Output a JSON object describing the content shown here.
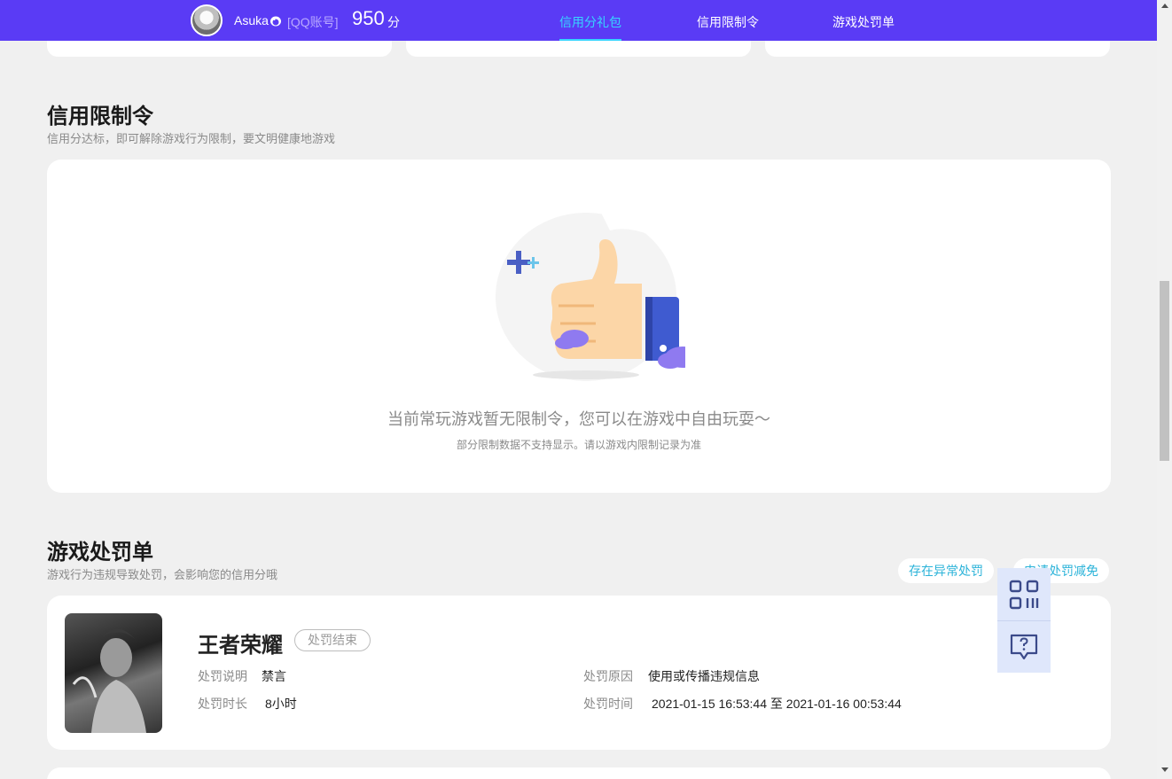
{
  "header": {
    "username": "Asuka",
    "account_tag": "[QQ账号]",
    "score": "950",
    "score_unit": "分",
    "tabs": [
      {
        "label": "信用分礼包",
        "active": true
      },
      {
        "label": "信用限制令",
        "active": false
      },
      {
        "label": "游戏处罚单",
        "active": false
      }
    ]
  },
  "restrictions": {
    "title": "信用限制令",
    "subtitle": "信用分达标，即可解除游戏行为限制，要文明健康地游戏",
    "empty_message": "当前常玩游戏暂无限制令，您可以在游戏中自由玩耍～",
    "empty_note": "部分限制数据不支持显示。请以游戏内限制记录为准"
  },
  "penalties": {
    "title": "游戏处罚单",
    "subtitle": "游戏行为违规导致处罚，会影响您的信用分哦",
    "actions": [
      "存在异常处罚",
      "申请处罚减免"
    ],
    "items": [
      {
        "game": "王者荣耀",
        "status": "处罚结束",
        "desc_label": "处罚说明",
        "desc_value": "禁言",
        "duration_label": "处罚时长",
        "duration_value": "8小时",
        "reason_label": "处罚原因",
        "reason_value": "使用或传播违规信息",
        "time_label": "处罚时间",
        "time_value": "2021-01-15 16:53:44 至 2021-01-16 00:53:44"
      }
    ]
  },
  "colors": {
    "nav_bg": "#5a3bf5",
    "active_tab": "#36d6ff",
    "link": "#2bb3d9"
  },
  "icons": {
    "float_tools": [
      "qrcode-icon",
      "help-feedback-icon"
    ]
  }
}
